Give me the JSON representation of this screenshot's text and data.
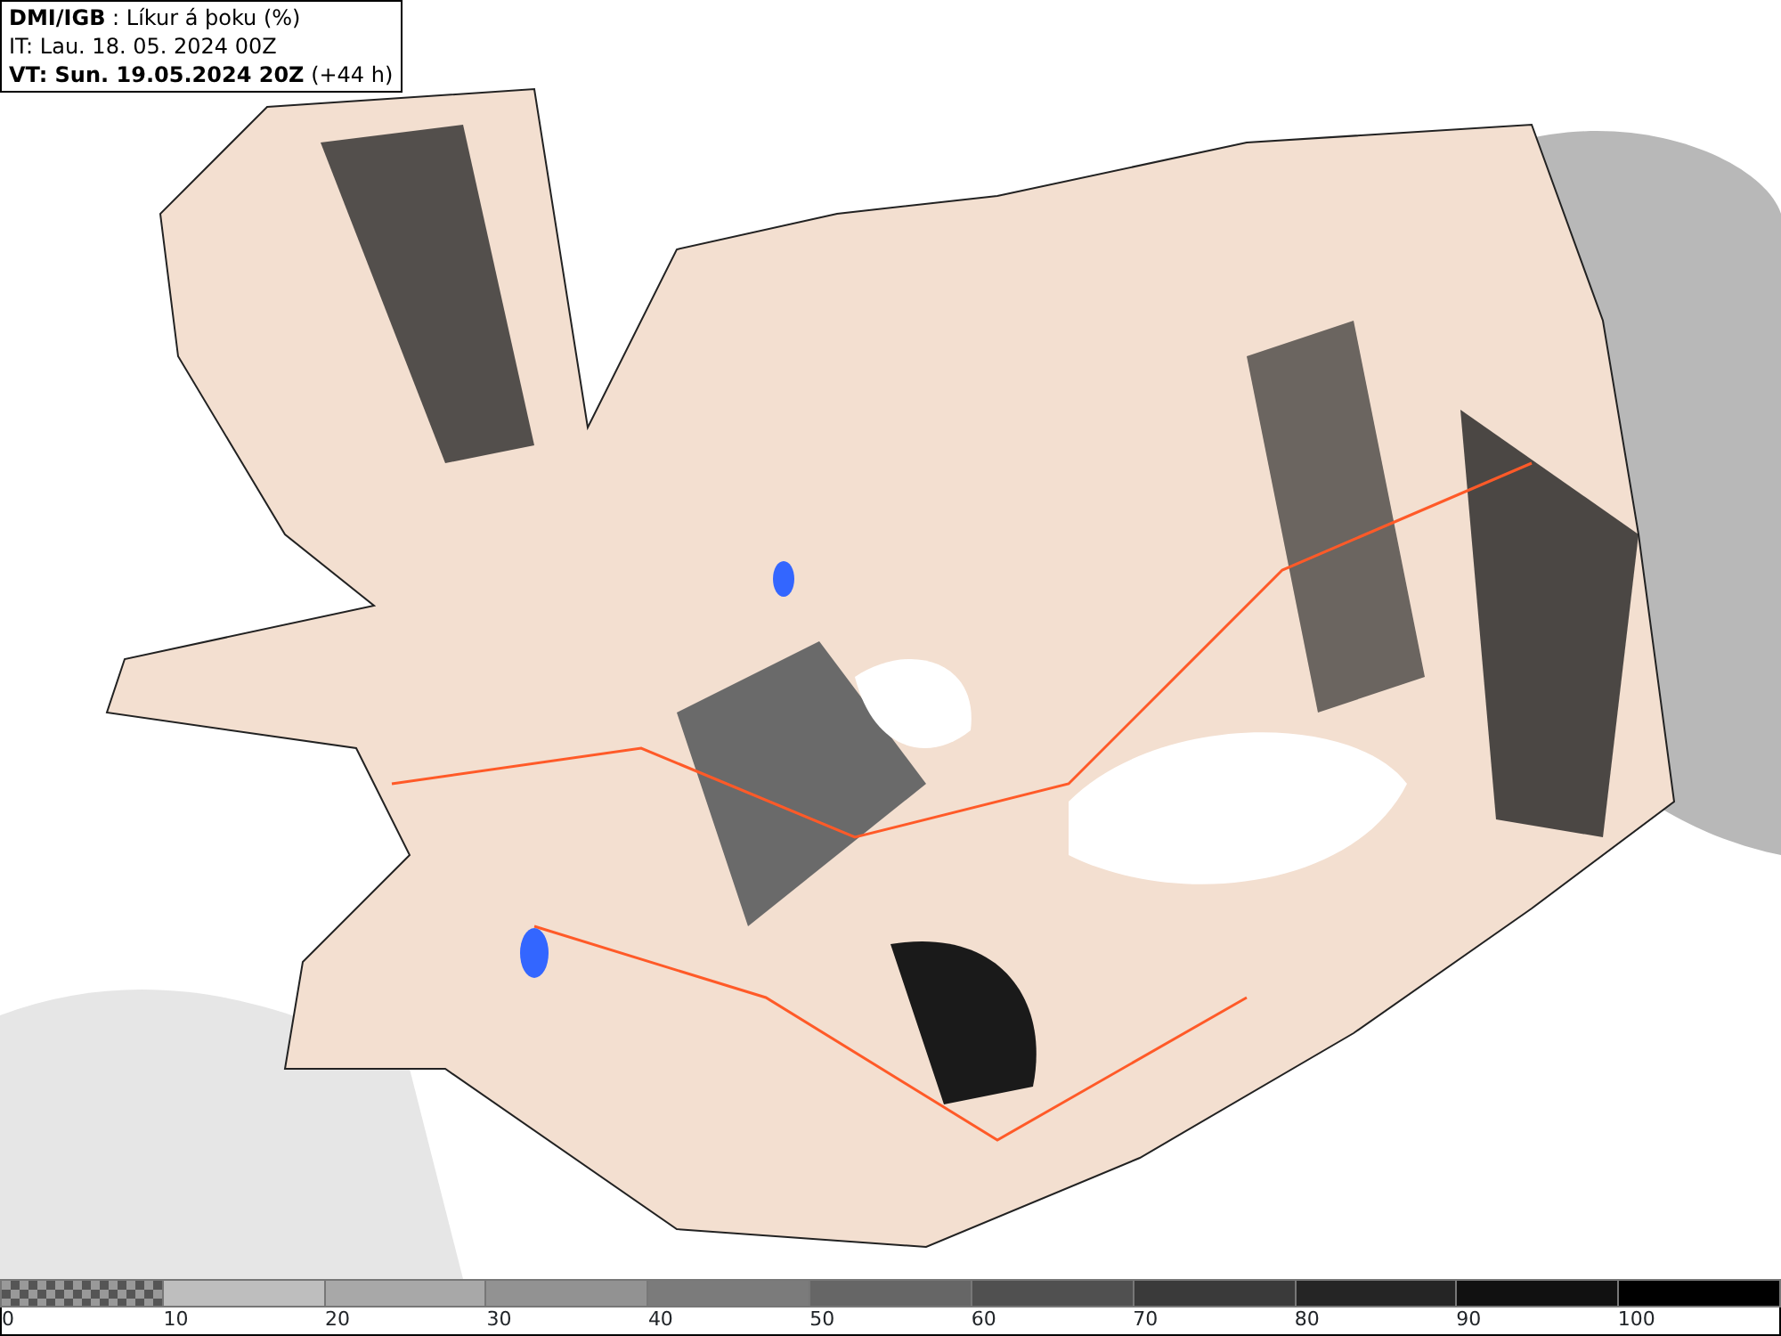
{
  "header": {
    "lines": [
      "**DMI/IGB** : Líkur á þoku (%)",
      "IT: Lau. 18. 05. 2024 00Z",
      "**VT: Sun. 19.05.2024 20Z** (+44 h)"
    ]
  },
  "legend": [
    {
      "label": "0",
      "kind": "checker",
      "color": "#555555"
    },
    {
      "label": "10",
      "kind": "solid",
      "color": "#bebebe"
    },
    {
      "label": "20",
      "kind": "solid",
      "color": "#a8a8a8"
    },
    {
      "label": "30",
      "kind": "solid",
      "color": "#929292"
    },
    {
      "label": "40",
      "kind": "solid",
      "color": "#7b7b7b"
    },
    {
      "label": "50",
      "kind": "solid",
      "color": "#666666"
    },
    {
      "label": "60",
      "kind": "solid",
      "color": "#505050"
    },
    {
      "label": "70",
      "kind": "solid",
      "color": "#3a3a3a"
    },
    {
      "label": "80",
      "kind": "solid",
      "color": "#252525"
    },
    {
      "label": "90",
      "kind": "solid",
      "color": "#111111"
    },
    {
      "label": "100",
      "kind": "solid",
      "color": "#000000"
    }
  ]
}
